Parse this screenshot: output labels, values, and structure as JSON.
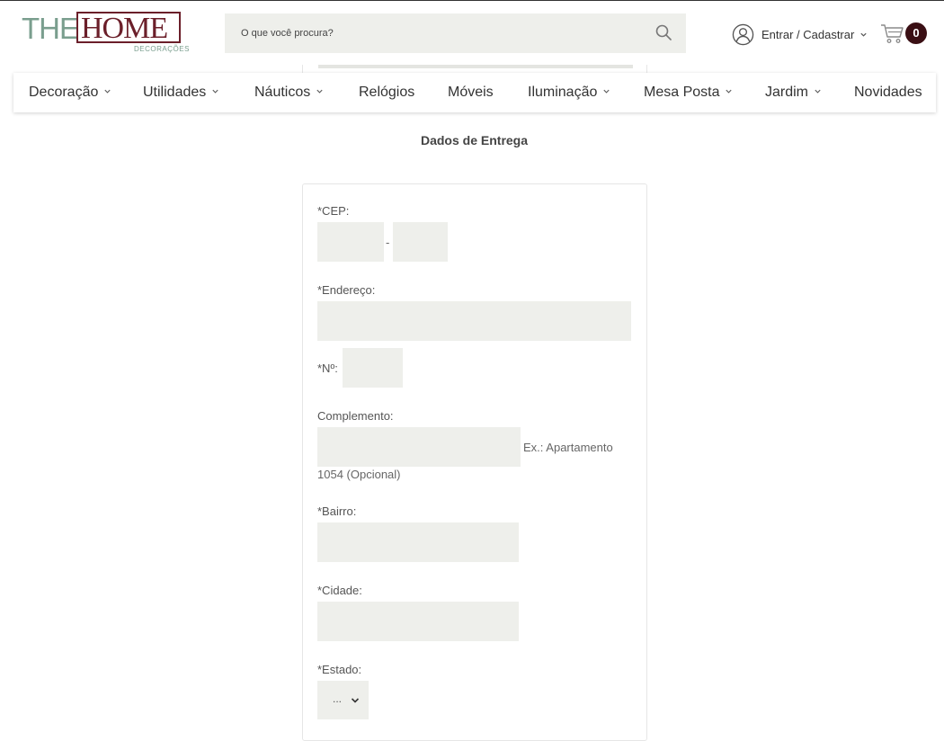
{
  "header": {
    "logo": {
      "the": "THE",
      "home": "HOME",
      "subtitle": "DECORAÇÕES"
    },
    "search": {
      "placeholder": "O que você procura?"
    },
    "account_label": "Entrar / Cadastrar",
    "cart_count": "0"
  },
  "nav": {
    "items": [
      {
        "label": "Decoração",
        "has_dropdown": true
      },
      {
        "label": "Utilidades",
        "has_dropdown": true
      },
      {
        "label": "Náuticos",
        "has_dropdown": true
      },
      {
        "label": "Relógios",
        "has_dropdown": false
      },
      {
        "label": "Móveis",
        "has_dropdown": false
      },
      {
        "label": "Iluminação",
        "has_dropdown": true
      },
      {
        "label": "Mesa Posta",
        "has_dropdown": true
      },
      {
        "label": "Jardim",
        "has_dropdown": true
      },
      {
        "label": "Novidades",
        "has_dropdown": false
      }
    ]
  },
  "form": {
    "title": "Dados de Entrega",
    "cep_label": "*CEP:",
    "cep_separator": "-",
    "endereco_label": "*Endereço:",
    "numero_label": "*Nº:",
    "complemento_label": "Complemento:",
    "complemento_hint_line1": "Ex.: Apartamento",
    "complemento_hint_line2": "1054 (Opcional)",
    "bairro_label": "*Bairro:",
    "cidade_label": "*Cidade:",
    "estado_label": "*Estado:",
    "estado_value": "..."
  },
  "colors": {
    "brand_green": "#7a9e8e",
    "brand_wine": "#6b1f2a",
    "cart_badge": "#3a0f14",
    "field_bg": "#eeefeb"
  }
}
